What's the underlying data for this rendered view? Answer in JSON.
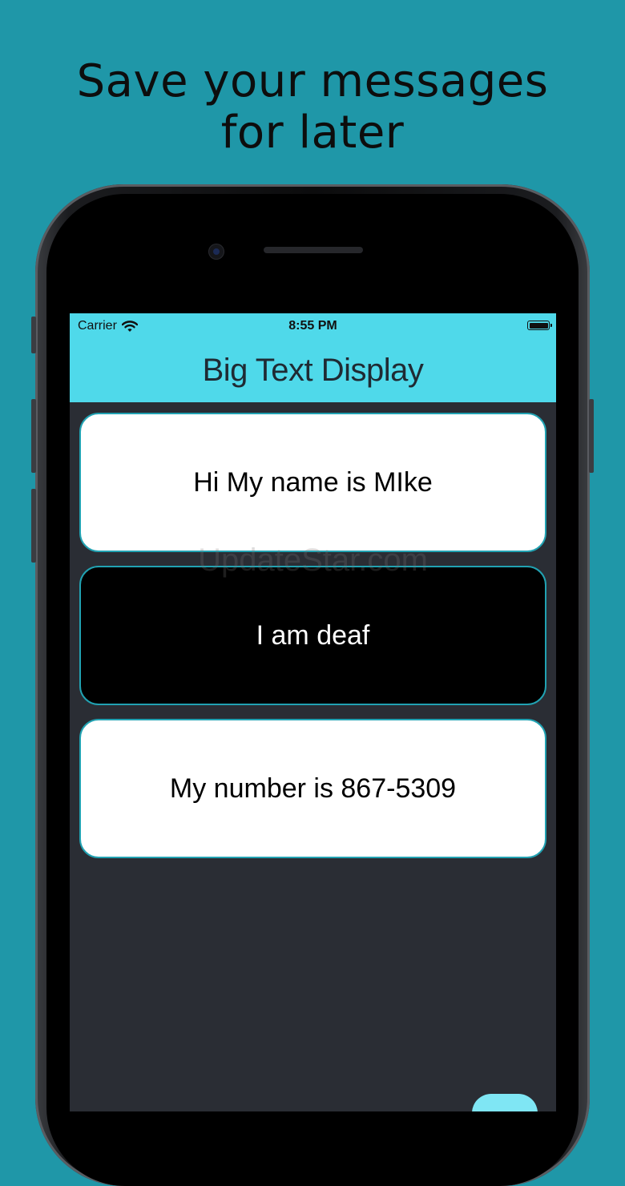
{
  "headline": {
    "line1": "Save your messages",
    "line2": "for later"
  },
  "status_bar": {
    "carrier": "Carrier",
    "time": "8:55 PM"
  },
  "nav": {
    "title": "Big Text Display"
  },
  "messages": [
    {
      "text": "Hi My name is MIke",
      "theme": "light"
    },
    {
      "text": "I am deaf",
      "theme": "dark"
    },
    {
      "text": "My number is 867-5309",
      "theme": "light"
    }
  ],
  "watermark": "UpdateStar.com",
  "colors": {
    "background": "#1f97a8",
    "nav_accent": "#4fd9ea",
    "screen_bg": "#2a2d34",
    "card_border": "#21a2b2",
    "fab": "#7fe6f4"
  }
}
